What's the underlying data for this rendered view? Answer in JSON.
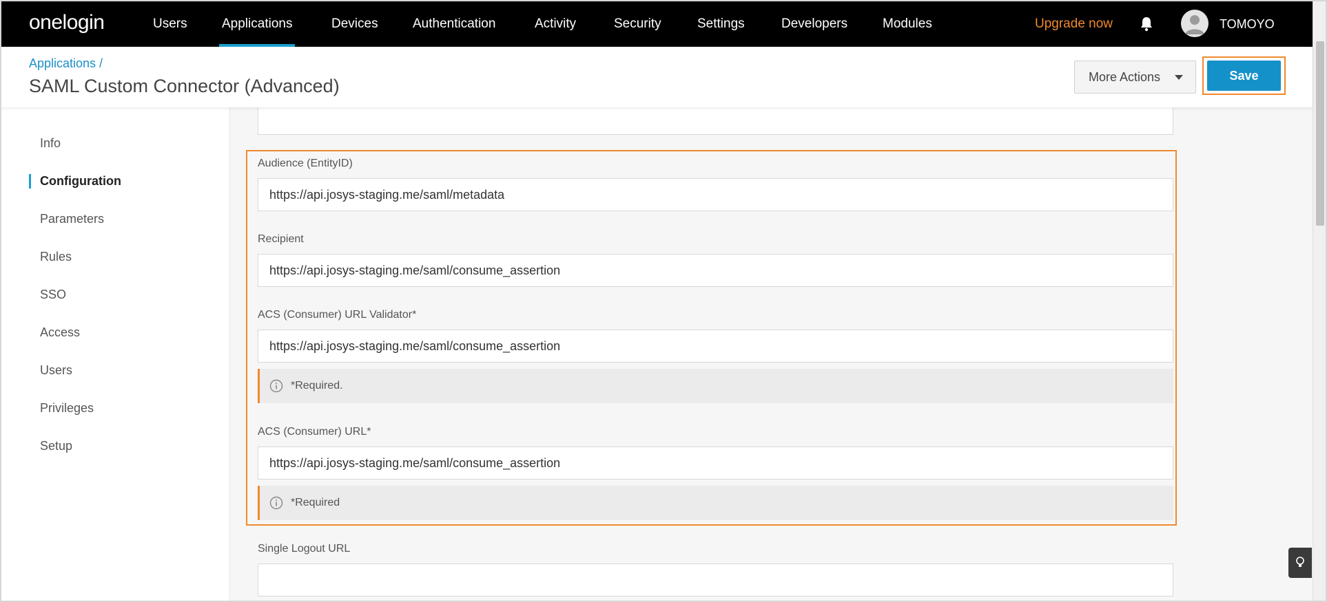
{
  "nav": {
    "logo": "onelogin",
    "items": [
      "Users",
      "Applications",
      "Devices",
      "Authentication",
      "Activity",
      "Security",
      "Settings",
      "Developers",
      "Modules"
    ],
    "active_item": "Applications",
    "upgrade": "Upgrade now",
    "username": "TOMOYO",
    "icons": {
      "bell": "bell-icon",
      "avatar": "avatar-icon"
    }
  },
  "header": {
    "breadcrumb": "Applications /",
    "title": "SAML Custom Connector (Advanced)",
    "more_actions": "More Actions",
    "save": "Save"
  },
  "sidebar": {
    "items": [
      "Info",
      "Configuration",
      "Parameters",
      "Rules",
      "SSO",
      "Access",
      "Users",
      "Privileges",
      "Setup"
    ],
    "active_item": "Configuration"
  },
  "form": {
    "top_field_value": "",
    "audience": {
      "label": "Audience (EntityID)",
      "value": "https://api.josys-staging.me/saml/metadata"
    },
    "recipient": {
      "label": "Recipient",
      "value": "https://api.josys-staging.me/saml/consume_assertion"
    },
    "acs_validator": {
      "label": "ACS (Consumer) URL Validator*",
      "value": "https://api.josys-staging.me/saml/consume_assertion",
      "note": "*Required."
    },
    "acs_url": {
      "label": "ACS (Consumer) URL*",
      "value": "https://api.josys-staging.me/saml/consume_assertion",
      "note": "*Required"
    },
    "single_logout": {
      "label": "Single Logout URL",
      "value": ""
    }
  },
  "colors": {
    "accent": "#1b9fd1",
    "highlight": "#f0892e",
    "save": "#1591c9",
    "nav_bg": "#000000"
  }
}
